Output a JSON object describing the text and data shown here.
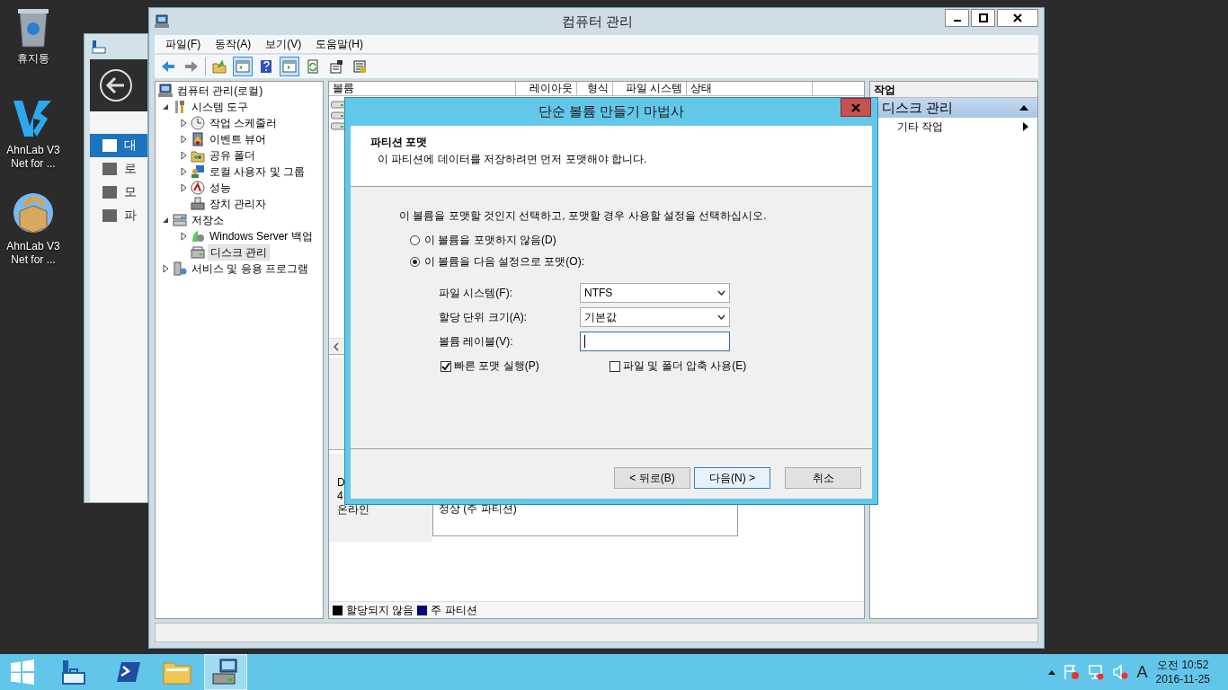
{
  "desktop_icons": [
    {
      "kind": "recycle-bin",
      "lines": [
        "휴지통"
      ]
    },
    {
      "kind": "v3",
      "lines": [
        "AhnLab V3",
        "Net for ..."
      ]
    },
    {
      "kind": "package",
      "lines": [
        "AhnLab V3",
        "Net for ..."
      ]
    }
  ],
  "back_window": {
    "nav": [
      {
        "label": "대",
        "kind": "dashboard",
        "selected": true
      },
      {
        "label": "로",
        "kind": "local",
        "selected": false
      },
      {
        "label": "모",
        "kind": "all",
        "selected": false
      },
      {
        "label": "파",
        "kind": "files",
        "selected": false
      }
    ]
  },
  "window": {
    "title": "컴퓨터 관리",
    "menu": [
      "파일(F)",
      "동작(A)",
      "보기(V)",
      "도움말(H)"
    ],
    "toolbar": [
      {
        "kind": "back",
        "pressed": false
      },
      {
        "kind": "forward",
        "pressed": false
      },
      {
        "kind": "separator"
      },
      {
        "kind": "up",
        "pressed": false
      },
      {
        "kind": "tree-pane",
        "pressed": true
      },
      {
        "kind": "help",
        "pressed": false
      },
      {
        "kind": "action-pane",
        "pressed": true
      },
      {
        "kind": "refresh",
        "pressed": false
      },
      {
        "kind": "properties",
        "pressed": false
      },
      {
        "kind": "export",
        "pressed": false
      }
    ],
    "tree": [
      {
        "label": "컴퓨터 관리(로컬)",
        "kind": "computer",
        "selected": false,
        "children": [
          {
            "label": "시스템 도구",
            "kind": "tools",
            "expanded": true,
            "selected": false,
            "children": [
              {
                "label": "작업 스케줄러",
                "kind": "clock",
                "expanded": false,
                "selected": false
              },
              {
                "label": "이벤트 뷰어",
                "kind": "event",
                "expanded": false,
                "selected": false
              },
              {
                "label": "공유 폴더",
                "kind": "share",
                "expanded": false,
                "selected": false
              },
              {
                "label": "로컬 사용자 및 그룹",
                "kind": "users",
                "expanded": false,
                "selected": false
              },
              {
                "label": "성능",
                "kind": "performance",
                "expanded": false,
                "selected": false
              },
              {
                "label": "장치 관리자",
                "kind": "device",
                "selected": false
              }
            ]
          },
          {
            "label": "저장소",
            "kind": "storage",
            "expanded": true,
            "selected": false,
            "children": [
              {
                "label": "Windows Server 백업",
                "kind": "backup",
                "expanded": false,
                "selected": false
              },
              {
                "label": "디스크 관리",
                "kind": "disk",
                "selected": true
              }
            ]
          },
          {
            "label": "서비스 및 응용 프로그램",
            "kind": "services",
            "expanded": false,
            "selected": false
          }
        ]
      }
    ],
    "volume_table": {
      "columns": [
        "볼륨",
        "레이아웃",
        "형식",
        "파일 시스템",
        "상태"
      ]
    },
    "disk_1": {
      "info": [
        "D",
        "4",
        "온라인"
      ],
      "partition_status": "정상 (주 파티션)"
    },
    "legend": [
      {
        "label": "할당되지 않음",
        "color": "#000000"
      },
      {
        "label": "주 파티션",
        "color": "#000080"
      }
    ],
    "actions": {
      "title": "작업",
      "sections": [
        {
          "label": "디스크 관리",
          "expanded": true,
          "items": [
            "기타 작업"
          ]
        }
      ]
    }
  },
  "dialog": {
    "title": "단순 볼륨 만들기 마법사",
    "heading": "파티션 포맷",
    "subheading": "이 파티션에 데이터를 저장하려면 먼저 포맷해야 합니다.",
    "instruction": "이 볼륨을 포맷할 것인지 선택하고, 포맷할 경우 사용할 설정을 선택하십시오.",
    "options": [
      {
        "label": "이 볼륨을 포맷하지 않음(D)",
        "selected": false
      },
      {
        "label": "이 볼륨을 다음 설정으로 포맷(O):",
        "selected": true
      }
    ],
    "fields": [
      {
        "label": "파일 시스템(F):",
        "kind": "dropdown",
        "value": "NTFS"
      },
      {
        "label": "할당 단위 크기(A):",
        "kind": "dropdown",
        "value": "기본값"
      },
      {
        "label": "볼륨 레이블(V):",
        "kind": "text"
      }
    ],
    "checkboxes": [
      {
        "label": "빠른 포맷 실행(P)",
        "checked": true
      },
      {
        "label": "파일 및 폴더 압축 사용(E)",
        "checked": false
      }
    ],
    "buttons": [
      {
        "label": "< 뒤로(B)",
        "kind": "back"
      },
      {
        "label": "다음(N) >",
        "kind": "default"
      },
      {
        "label": "취소",
        "kind": "cancel"
      }
    ]
  },
  "taskbar": {
    "apps": [
      {
        "kind": "server-manager",
        "selected": false
      },
      {
        "kind": "powershell",
        "selected": false
      },
      {
        "kind": "explorer",
        "selected": false
      },
      {
        "kind": "computer-management",
        "selected": true
      }
    ],
    "ime": "A",
    "time": "오전 10:52",
    "date": "2016-11-25"
  }
}
